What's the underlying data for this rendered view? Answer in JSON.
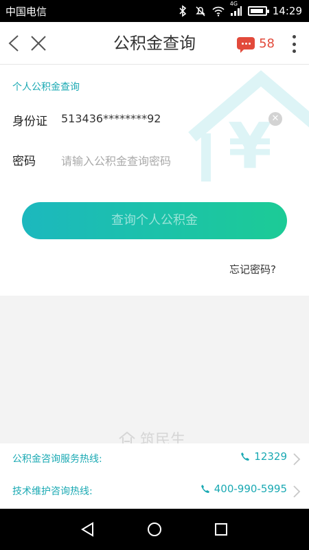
{
  "status_bar": {
    "carrier": "中国电信",
    "network_type": "4G",
    "time": "14:29",
    "battery_level": 0.9,
    "icons": [
      "bluetooth-icon",
      "mute-icon",
      "wifi-icon",
      "signal-icon",
      "battery-icon"
    ]
  },
  "navbar": {
    "title": "公积金查询",
    "message_count": "58",
    "icons": [
      "back-chevron-icon",
      "close-icon",
      "message-icon",
      "more-vertical-icon"
    ]
  },
  "form": {
    "section_title": "个人公积金查询",
    "id_label": "身份证",
    "id_value": "513436********92",
    "password_label": "密码",
    "password_placeholder": "请输入公积金查询密码",
    "query_button": "查询个人公积金",
    "forgot_link": "忘记密码?"
  },
  "watermark": {
    "text": "筑民生"
  },
  "hotlines": [
    {
      "label": "公积金咨询服务热线:",
      "number": "12329"
    },
    {
      "label": "技术维护咨询热线:",
      "number": "400-990-5995"
    }
  ],
  "colors": {
    "accent": "#1aa9b3",
    "button_gradient_start": "#1cb8be",
    "button_gradient_end": "#1ccb96",
    "badge": "#e24a3b"
  }
}
